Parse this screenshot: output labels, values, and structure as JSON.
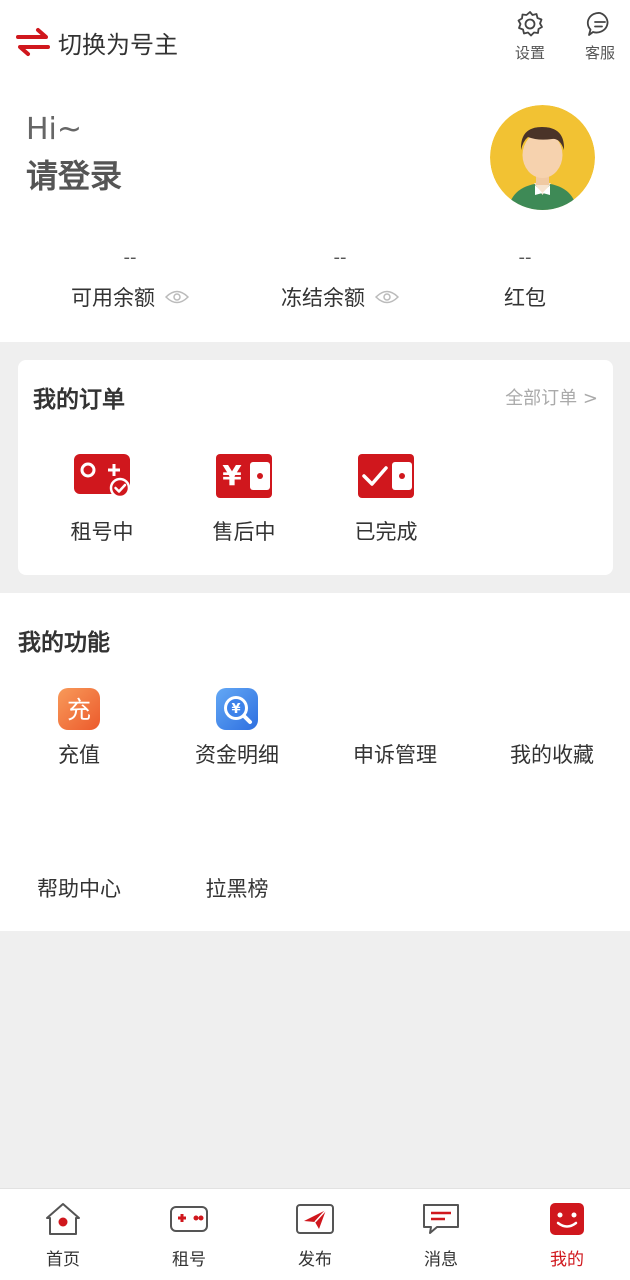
{
  "header": {
    "switch_label": "切换为号主",
    "settings_label": "设置",
    "service_label": "客服"
  },
  "profile": {
    "greeting": "Hi~",
    "login_prompt": "请登录"
  },
  "balances": [
    {
      "value": "--",
      "label": "可用余额"
    },
    {
      "value": "--",
      "label": "冻结余额"
    },
    {
      "value": "--",
      "label": "红包"
    }
  ],
  "orders": {
    "title": "我的订单",
    "all_link": "全部订单 >",
    "items": [
      {
        "label": "租号中",
        "icon": "gamepad-check-icon"
      },
      {
        "label": "售后中",
        "icon": "yen-wallet-icon"
      },
      {
        "label": "已完成",
        "icon": "check-wallet-icon"
      }
    ]
  },
  "functions": {
    "title": "我的功能",
    "items": [
      {
        "label": "充值",
        "icon_text": "充"
      },
      {
        "label": "资金明细",
        "icon_text": "¥"
      },
      {
        "label": "申诉管理"
      },
      {
        "label": "我的收藏"
      },
      {
        "label": "帮助中心"
      },
      {
        "label": "拉黑榜"
      }
    ]
  },
  "nav": [
    {
      "label": "首页",
      "icon": "home-icon"
    },
    {
      "label": "租号",
      "icon": "gamepad-icon"
    },
    {
      "label": "发布",
      "icon": "send-icon"
    },
    {
      "label": "消息",
      "icon": "message-icon"
    },
    {
      "label": "我的",
      "icon": "me-icon",
      "active": true
    }
  ],
  "colors": {
    "accent": "#d0171d",
    "background": "#efefef",
    "avatar_bg": "#f2c233"
  }
}
